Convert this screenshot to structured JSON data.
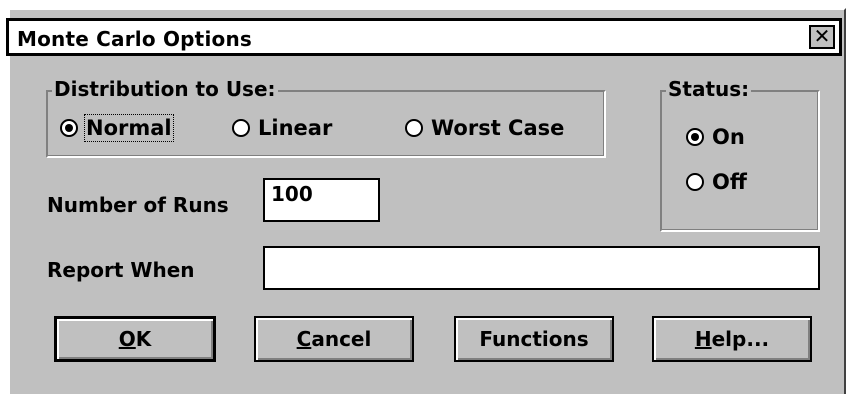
{
  "window": {
    "title": "Monte Carlo Options",
    "close_label": "✕"
  },
  "distribution": {
    "legend": "Distribution to Use:",
    "options": [
      {
        "label": "Normal",
        "selected": true
      },
      {
        "label": "Linear",
        "selected": false
      },
      {
        "label": "Worst Case",
        "selected": false
      }
    ]
  },
  "status": {
    "legend": "Status:",
    "options": [
      {
        "label": "On",
        "selected": true
      },
      {
        "label": "Off",
        "selected": false
      }
    ]
  },
  "runs": {
    "label": "Number of Runs",
    "value": "100"
  },
  "report": {
    "label": "Report When",
    "value": ""
  },
  "buttons": {
    "ok": {
      "accel": "O",
      "rest": "K"
    },
    "cancel": {
      "accel": "C",
      "rest": "ancel"
    },
    "functions": {
      "label": "Functions"
    },
    "help": {
      "accel": "H",
      "rest": "elp..."
    }
  }
}
